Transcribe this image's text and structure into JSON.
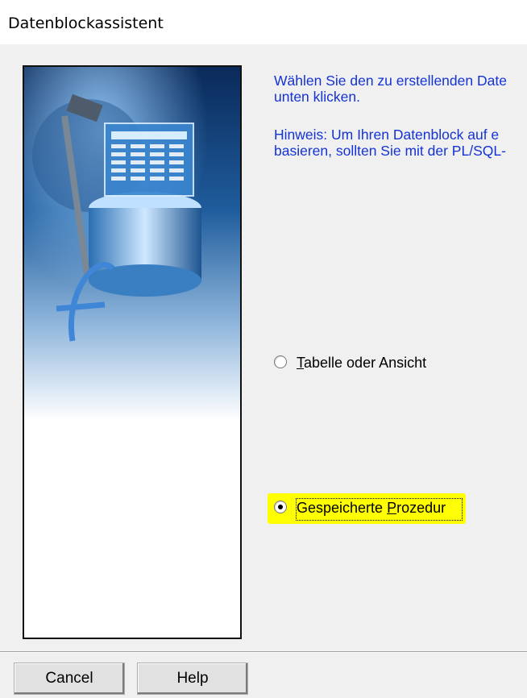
{
  "window": {
    "title": "Datenblockassistent"
  },
  "instructions": {
    "line1": "Wählen Sie den zu erstellenden Date",
    "line2": "unten klicken.",
    "hint_line1": "Hinweis: Um Ihren Datenblock auf e",
    "hint_line2": "basieren, sollten Sie mit der PL/SQL-"
  },
  "options": {
    "table": {
      "label_first": "T",
      "label_rest": "abelle oder Ansicht",
      "selected": false
    },
    "procedure": {
      "label_first": "Gespeicherte ",
      "label_underlined": "P",
      "label_rest": "rozedur",
      "selected": true
    }
  },
  "colors": {
    "highlight": "#ffff00",
    "instruction_text": "#1433d6"
  },
  "buttons": {
    "cancel": "Cancel",
    "help": "Help"
  }
}
